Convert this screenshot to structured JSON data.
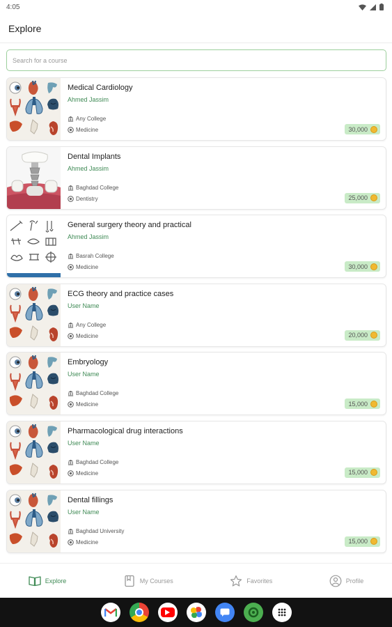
{
  "status_bar": {
    "time": "4:05"
  },
  "app_bar": {
    "title": "Explore"
  },
  "search": {
    "placeholder": "Search for a course"
  },
  "courses": [
    {
      "title": "Medical Cardiology",
      "author": "Ahmed Jassim",
      "college": "Any College",
      "department": "Medicine",
      "price": "30,000",
      "image": "organs"
    },
    {
      "title": "Dental Implants",
      "author": "Ahmed Jassim",
      "college": "Baghdad College",
      "department": "Dentistry",
      "price": "25,000",
      "image": "dental"
    },
    {
      "title": "General surgery theory and practical",
      "author": "Ahmed Jassim",
      "college": "Basrah College",
      "department": "Medicine",
      "price": "30,000",
      "image": "surgery"
    },
    {
      "title": "ECG theory and practice cases",
      "author": "User Name",
      "college": "Any College",
      "department": "Medicine",
      "price": "20,000",
      "image": "organs"
    },
    {
      "title": "Embryology",
      "author": "User Name",
      "college": "Baghdad College",
      "department": "Medicine",
      "price": "15,000",
      "image": "organs"
    },
    {
      "title": "Pharmacological drug interactions",
      "author": "User Name",
      "college": "Baghdad College",
      "department": "Medicine",
      "price": "15,000",
      "image": "organs"
    },
    {
      "title": "Dental fillings",
      "author": "User Name",
      "college": "Baghdad University",
      "department": "Medicine",
      "price": "15,000",
      "image": "organs"
    }
  ],
  "bottom_nav": {
    "explore": "Explore",
    "my_courses": "My Courses",
    "favorites": "Favorites",
    "profile": "Profile"
  },
  "dock_apps": [
    "gmail-icon",
    "chrome-icon",
    "youtube-icon",
    "photos-icon",
    "messages-icon",
    "app-icon",
    "app-drawer-icon"
  ],
  "colors": {
    "accent": "#3f8a55",
    "price_bg": "#c9ebc7",
    "coin": "#f0b931",
    "search_border": "#9ccf9c"
  }
}
